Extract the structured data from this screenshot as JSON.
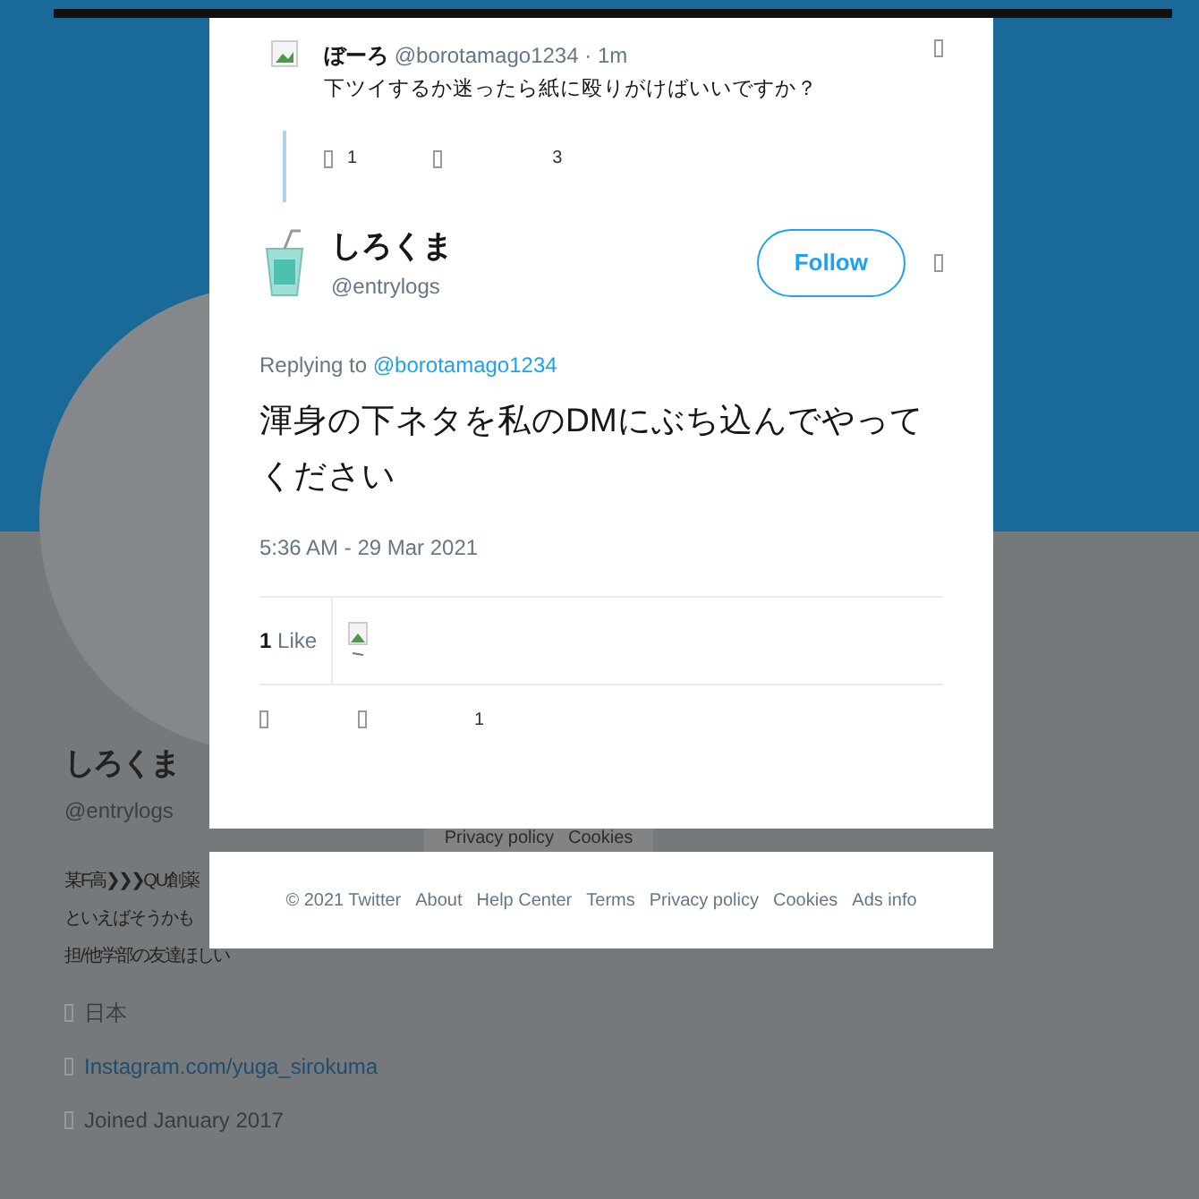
{
  "profile": {
    "name": "しろくま",
    "handle": "@entrylogs",
    "bio": [
      "某F高❯❯❯QU創薬",
      "といえばそうかも",
      "担/他学部の友達ほしい"
    ],
    "location": "日本",
    "website": "Instagram.com/yuga_sirokuma",
    "joined": "Joined January 2017"
  },
  "background_footer": [
    "Privacy policy",
    "Cookies"
  ],
  "parent_tweet": {
    "name": "ぼーろ",
    "handle": "@borotamago1234",
    "time": "· 1m",
    "text": "下ツイするか迷ったら紙に殴りがけばいいですか？",
    "reply_count": "1",
    "like_count": "3"
  },
  "tweet": {
    "name": "しろくま",
    "handle": "@entrylogs",
    "follow_button": "Follow",
    "replying_label": "Replying to",
    "replying_to": "@borotamago1234",
    "text": "渾身の下ネタを私のDMにぶち込んでやってください",
    "timestamp": "5:36 AM - 29 Mar 2021",
    "likes_count": "1",
    "likes_label": "Like",
    "like_count": "1"
  },
  "footer": [
    "© 2021 Twitter",
    "About",
    "Help Center",
    "Terms",
    "Privacy policy",
    "Cookies",
    "Ads info"
  ]
}
